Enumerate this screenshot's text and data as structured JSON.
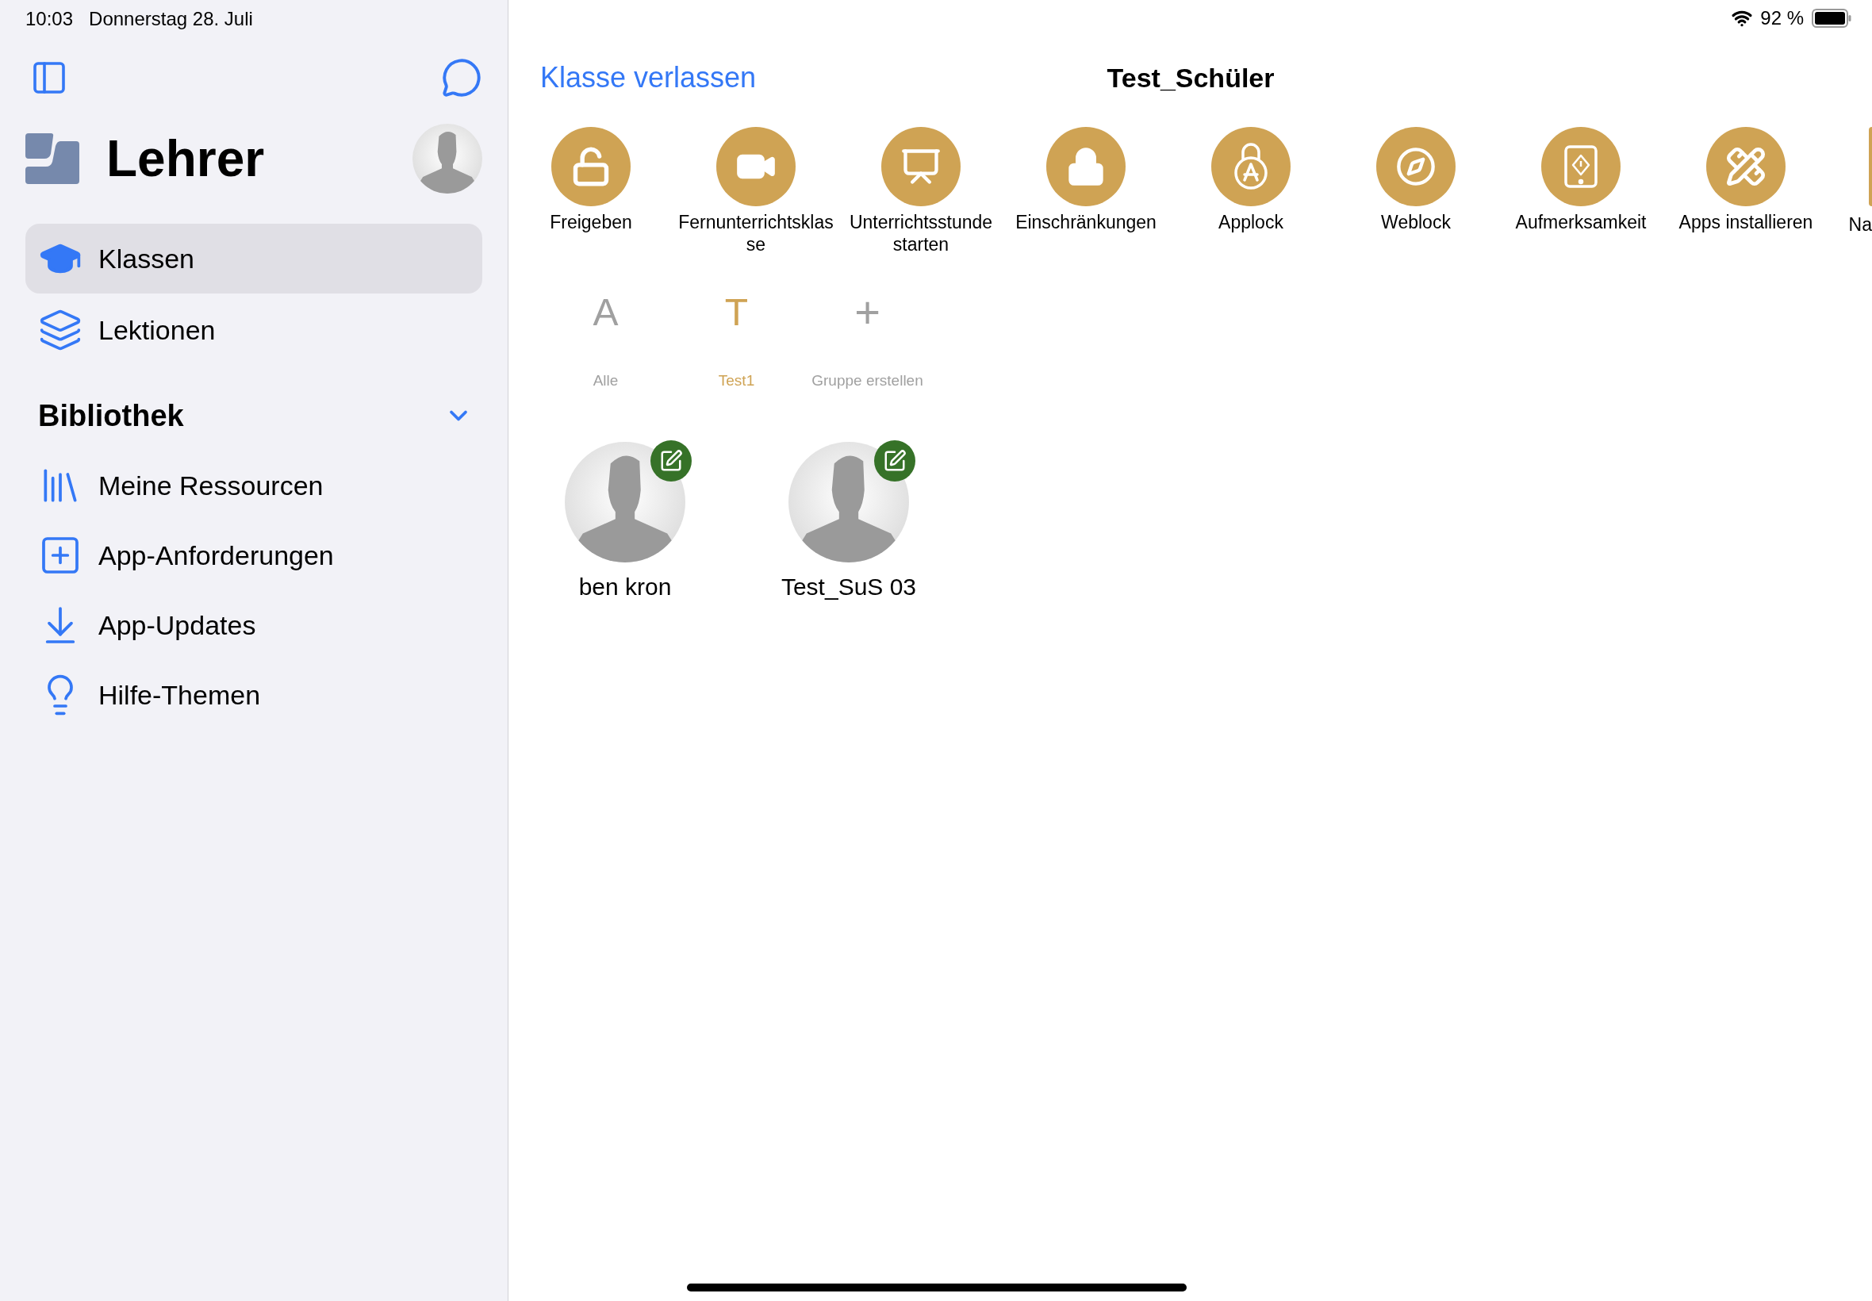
{
  "status_bar": {
    "time": "10:03",
    "date": "Donnerstag 28. Juli",
    "battery": "92 %"
  },
  "sidebar": {
    "title": "Lehrer",
    "items": [
      {
        "label": "Klassen",
        "selected": true
      },
      {
        "label": "Lektionen",
        "selected": false
      }
    ],
    "library": {
      "title": "Bibliothek",
      "expanded": true,
      "items": [
        {
          "label": "Meine Ressourcen"
        },
        {
          "label": "App-Anforderungen"
        },
        {
          "label": "App-Updates"
        },
        {
          "label": "Hilfe-Themen"
        }
      ]
    }
  },
  "header": {
    "back_link": "Klasse verlassen",
    "title": "Test_Schüler"
  },
  "actions": [
    {
      "label": "Freigeben",
      "kind": "full"
    },
    {
      "label": "Fernunterrichtsklasse",
      "kind": "full"
    },
    {
      "label": "Unterrichtsstunde starten",
      "kind": "full"
    },
    {
      "label": "Einschränkungen",
      "kind": "full"
    },
    {
      "label": "Applock",
      "kind": "full"
    },
    {
      "label": "Weblock",
      "kind": "full"
    },
    {
      "label": "Aufmerksamkeit",
      "kind": "full"
    },
    {
      "label": "Apps installieren",
      "kind": "full"
    },
    {
      "label": "Na",
      "kind": "partial"
    }
  ],
  "groups": [
    {
      "symbol": "A",
      "label": "Alle",
      "selected": false,
      "kind": "group"
    },
    {
      "symbol": "T",
      "label": "Test1",
      "selected": true,
      "kind": "group"
    },
    {
      "symbol": "+",
      "label": "Gruppe erstellen",
      "selected": false,
      "kind": "create"
    }
  ],
  "students": [
    {
      "name": "ben kron"
    },
    {
      "name": "Test_SuS 03"
    }
  ]
}
